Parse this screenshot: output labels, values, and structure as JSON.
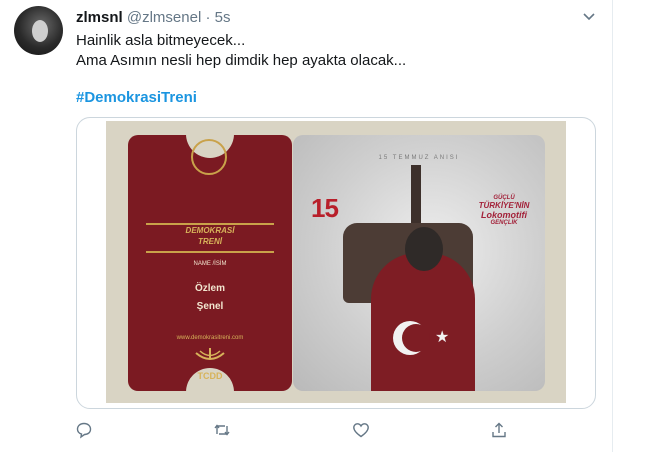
{
  "tweet": {
    "display_name": "zlmsnl",
    "handle": "@zlmsenel",
    "separator": "·",
    "time": "5s",
    "lines": [
      "Hainlik asla bitmeyecek...",
      "Ama Asımın nesli hep dimdik hep ayakta olacak..."
    ],
    "hashtag": "#DemokrasiTreni"
  },
  "card": {
    "ticket": {
      "ribbon_line1": "DEMOKRASİ",
      "ribbon_line2": "TRENİ",
      "name_label": "NAME /İSİM",
      "first_name": "Özlem",
      "last_name": "Şenel",
      "url": "www.demokrasitreni.com",
      "logo_text": "TCDD"
    },
    "photo": {
      "header": "15 TEMMUZ ANISI",
      "badge": "15",
      "slogan_line1": "GÜÇLÜ",
      "slogan_line2": "TÜRKİYE'NİN",
      "slogan_line3": "Lokomotifi",
      "slogan_line4": "GENÇLİK"
    }
  },
  "actions": [
    "reply-icon",
    "retweet-icon",
    "like-icon",
    "share-icon"
  ],
  "colors": {
    "link": "#1b95e0",
    "ticket": "#7b1a22",
    "icon": "#657786"
  }
}
